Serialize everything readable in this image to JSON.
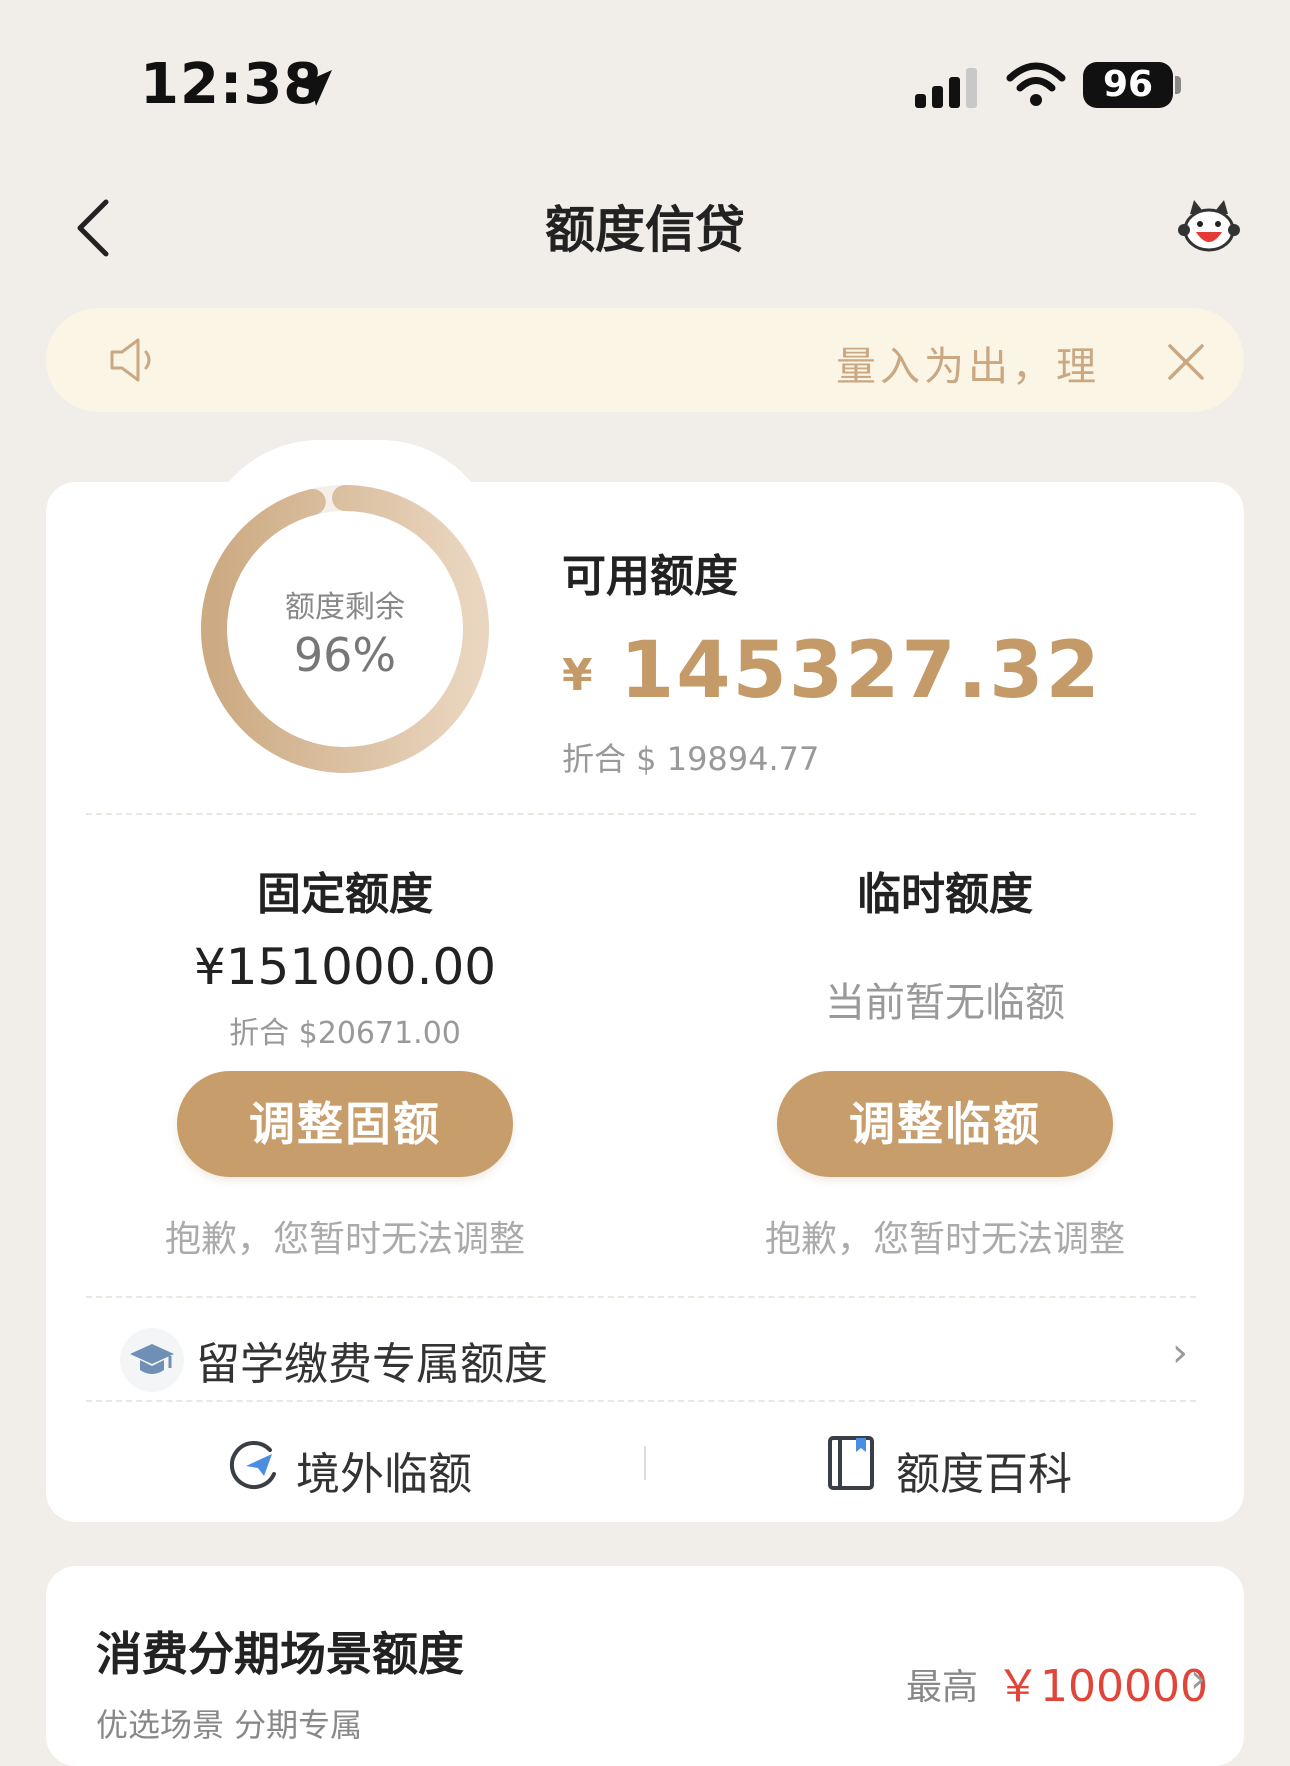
{
  "status_bar": {
    "time": "12:38",
    "battery": "96"
  },
  "nav": {
    "title": "额度信贷"
  },
  "notice": {
    "text": "量入为出，理"
  },
  "credit": {
    "ring_label": "额度剩余",
    "ring_percent_text": "96%",
    "remaining_fraction": 0.96,
    "available_title": "可用额度",
    "currency_symbol": "¥",
    "available_amount": "145327.32",
    "available_usd": "折合 $ 19894.77"
  },
  "fixed": {
    "title": "固定额度",
    "amount": "¥151000.00",
    "usd": "折合 $20671.00",
    "button": "调整固额",
    "note": "抱歉，您暂时无法调整"
  },
  "temporary": {
    "title": "临时额度",
    "status": "当前暂无临额",
    "button": "调整临额",
    "note": "抱歉，您暂时无法调整"
  },
  "study": {
    "label": "留学缴费专属额度",
    "chevron": "›"
  },
  "links": {
    "overseas": "境外临额",
    "encyclopedia": "额度百科"
  },
  "installment": {
    "title": "消费分期场景额度",
    "max_label": "最高",
    "max_value": "￥100000",
    "chevron": "›",
    "subtitle": "优选场景 分期专属"
  },
  "colors": {
    "accent": "#c79d6b",
    "amount": "#c59a69",
    "red": "#e0453a",
    "notice_bg": "#fbf5e6"
  }
}
